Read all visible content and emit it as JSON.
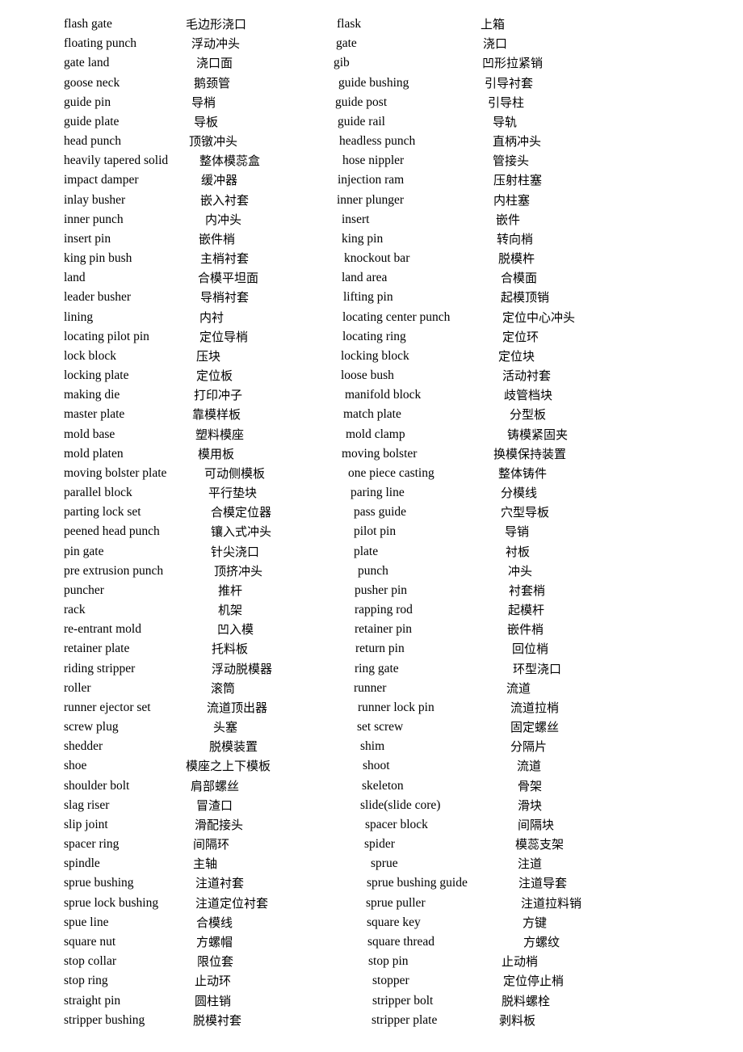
{
  "glossary": {
    "rows": [
      {
        "en1": "flash gate",
        "zh1": "毛边形浇口",
        "en2": "flask",
        "zh2": "上箱"
      },
      {
        "en1": "floating punch",
        "zh1": "浮动冲头",
        "en2": "gate",
        "zh2": "浇口"
      },
      {
        "en1": "gate land",
        "zh1": "浇口面",
        "en2": "gib",
        "zh2": "凹形拉紧销"
      },
      {
        "en1": "goose neck",
        "zh1": "鹅颈管",
        "en2": "guide bushing",
        "zh2": "引导衬套"
      },
      {
        "en1": "guide pin",
        "zh1": "导梢",
        "en2": "guide post",
        "zh2": "引导柱"
      },
      {
        "en1": "guide plate",
        "zh1": "导板",
        "en2": "guide rail",
        "zh2": "导轨"
      },
      {
        "en1": "head punch",
        "zh1": "顶镦冲头",
        "en2": "headless punch",
        "zh2": "直柄冲头"
      },
      {
        "en1": "heavily tapered solid",
        "zh1": "整体模蕊盒",
        "en2": "hose nippler",
        "zh2": "管接头"
      },
      {
        "en1": "impact damper",
        "zh1": "缓冲器",
        "en2": "injection ram",
        "zh2": "压射柱塞"
      },
      {
        "en1": "inlay busher",
        "zh1": "嵌入衬套",
        "en2": "inner plunger",
        "zh2": "内柱塞"
      },
      {
        "en1": "inner punch",
        "zh1": "内冲头",
        "en2": "insert",
        "zh2": "嵌件"
      },
      {
        "en1": "insert pin",
        "zh1": "嵌件梢",
        "en2": "king pin",
        "zh2": "转向梢"
      },
      {
        "en1": "king pin bush",
        "zh1": "主梢衬套",
        "en2": "knockout bar",
        "zh2": "脱模杵"
      },
      {
        "en1": "land",
        "zh1": "合模平坦面",
        "en2": "land area",
        "zh2": "合模面"
      },
      {
        "en1": "leader busher",
        "zh1": "导梢衬套",
        "en2": "lifting pin",
        "zh2": "起模顶销"
      },
      {
        "en1": "lining",
        "zh1": "内衬",
        "en2": "locating center punch",
        "zh2": "定位中心冲头"
      },
      {
        "en1": "locating pilot pin",
        "zh1": "定位导梢",
        "en2": "locating ring",
        "zh2": "定位环"
      },
      {
        "en1": "lock block",
        "zh1": "压块",
        "en2": "locking block",
        "zh2": "定位块"
      },
      {
        "en1": "locking plate",
        "zh1": "定位板",
        "en2": "loose bush",
        "zh2": "活动衬套"
      },
      {
        "en1": "making die",
        "zh1": "打印冲子",
        "en2": "manifold block",
        "zh2": "歧管档块"
      },
      {
        "en1": "master plate",
        "zh1": "靠模样板",
        "en2": "match plate",
        "zh2": "分型板"
      },
      {
        "en1": "mold base",
        "zh1": "塑料模座",
        "en2": "mold clamp",
        "zh2": "铸模紧固夹"
      },
      {
        "en1": "mold platen",
        "zh1": "模用板",
        "en2": "moving bolster",
        "zh2": "换模保持装置"
      },
      {
        "en1": "moving bolster plate",
        "zh1": "可动侧模板",
        "en2": "one piece casting",
        "zh2": "整体铸件"
      },
      {
        "en1": "parallel block",
        "zh1": "平行垫块",
        "en2": "paring line",
        "zh2": "分模线"
      },
      {
        "en1": "parting lock set",
        "zh1": "合模定位器",
        "en2": "pass guide",
        "zh2": "穴型导板"
      },
      {
        "en1": "peened head punch",
        "zh1": "镶入式冲头",
        "en2": "pilot pin",
        "zh2": "导销"
      },
      {
        "en1": "pin gate",
        "zh1": "针尖浇口",
        "en2": "plate",
        "zh2": "衬板"
      },
      {
        "en1": "pre extrusion punch",
        "zh1": "顶挤冲头",
        "en2": "punch",
        "zh2": "冲头"
      },
      {
        "en1": "puncher",
        "zh1": "推杆",
        "en2": "pusher pin",
        "zh2": "衬套梢"
      },
      {
        "en1": "rack",
        "zh1": "机架",
        "en2": "rapping rod",
        "zh2": "起模杆"
      },
      {
        "en1": "re-entrant mold",
        "zh1": "凹入模",
        "en2": "retainer pin",
        "zh2": "嵌件梢"
      },
      {
        "en1": "retainer plate",
        "zh1": "托料板",
        "en2": "return pin",
        "zh2": "回位梢"
      },
      {
        "en1": "riding stripper",
        "zh1": "浮动脱模器",
        "en2": "ring gate",
        "zh2": "环型浇口"
      },
      {
        "en1": "roller",
        "zh1": "滚筒",
        "en2": "runner",
        "zh2": "流道"
      },
      {
        "en1": "runner ejector set",
        "zh1": "流道顶出器",
        "en2": "runner lock pin",
        "zh2": "流道拉梢"
      },
      {
        "en1": "screw plug",
        "zh1": "头塞",
        "en2": "set screw",
        "zh2": "固定螺丝"
      },
      {
        "en1": "shedder",
        "zh1": "脱模装置",
        "en2": "shim",
        "zh2": "分隔片"
      },
      {
        "en1": "shoe",
        "zh1": "模座之上下模板",
        "en2": "shoot",
        "zh2": "流道"
      },
      {
        "en1": "shoulder bolt",
        "zh1": "肩部螺丝",
        "en2": "skeleton",
        "zh2": "骨架"
      },
      {
        "en1": "slag riser",
        "zh1": "冒渣口",
        "en2": "slide(slide core)",
        "zh2": "滑块"
      },
      {
        "en1": "slip joint",
        "zh1": "滑配接头",
        "en2": "spacer block",
        "zh2": "间隔块"
      },
      {
        "en1": "spacer ring",
        "zh1": "间隔环",
        "en2": "spider",
        "zh2": "模蕊支架"
      },
      {
        "en1": "spindle",
        "zh1": "主轴",
        "en2": "sprue",
        "zh2": "注道"
      },
      {
        "en1": "sprue bushing",
        "zh1": "注道衬套",
        "en2": "sprue bushing guide",
        "zh2": "注道导套"
      },
      {
        "en1": "sprue lock bushing",
        "zh1": "注道定位衬套",
        "en2": "sprue puller",
        "zh2": "注道拉料销"
      },
      {
        "en1": "spue line",
        "zh1": "合模线",
        "en2": "square key",
        "zh2": "方键"
      },
      {
        "en1": "square nut",
        "zh1": "方螺帽",
        "en2": "square thread",
        "zh2": "方螺纹"
      },
      {
        "en1": "stop collar",
        "zh1": "限位套",
        "en2": "stop pin",
        "zh2": "止动梢"
      },
      {
        "en1": "stop ring",
        "zh1": "止动环",
        "en2": "stopper",
        "zh2": "定位停止梢"
      },
      {
        "en1": "straight pin",
        "zh1": "圆柱销",
        "en2": "stripper bolt",
        "zh2": "脱料螺栓"
      },
      {
        "en1": "stripper bushing",
        "zh1": "脱模衬套",
        "en2": "stripper plate",
        "zh2": "剥料板"
      }
    ]
  }
}
